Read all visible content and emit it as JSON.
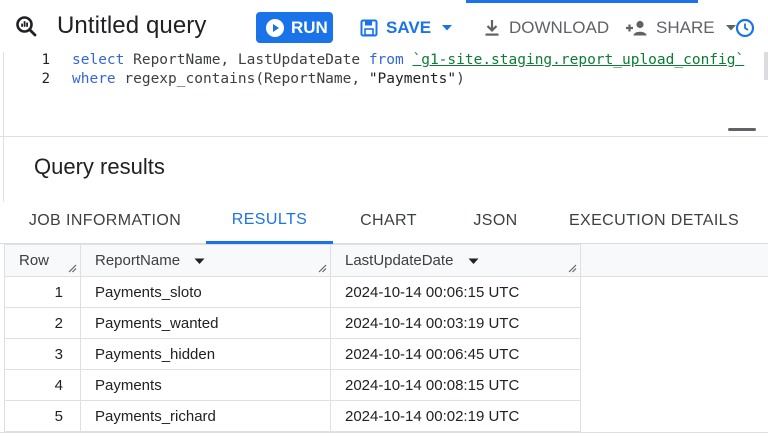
{
  "header": {
    "title": "Untitled query",
    "run_label": "RUN",
    "save_label": "SAVE",
    "download_label": "DOWNLOAD",
    "share_label": "SHARE"
  },
  "editor": {
    "line_numbers": [
      "1",
      "2"
    ],
    "line1": {
      "kw_select": "select",
      "cols": " ReportName, LastUpdateDate ",
      "kw_from": "from",
      "table": "`g1-site.staging.report_upload_config`"
    },
    "line2": {
      "kw_where": "where",
      "func": " regexp_contains(ReportName, ",
      "str": "\"Payments\"",
      "close": ")"
    }
  },
  "results": {
    "title": "Query results",
    "tabs": [
      "JOB INFORMATION",
      "RESULTS",
      "CHART",
      "JSON",
      "EXECUTION DETAILS"
    ],
    "active_tab": "RESULTS",
    "columns": [
      "Row",
      "ReportName",
      "LastUpdateDate"
    ],
    "rows": [
      {
        "row": "1",
        "name": "Payments_sloto",
        "date": "2024-10-14 00:06:15 UTC"
      },
      {
        "row": "2",
        "name": "Payments_wanted",
        "date": "2024-10-14 00:03:19 UTC"
      },
      {
        "row": "3",
        "name": "Payments_hidden",
        "date": "2024-10-14 00:06:45 UTC"
      },
      {
        "row": "4",
        "name": "Payments",
        "date": "2024-10-14 00:08:15 UTC"
      },
      {
        "row": "5",
        "name": "Payments_richard",
        "date": "2024-10-14 00:02:19 UTC"
      }
    ]
  },
  "colors": {
    "accent": "#1a73e8",
    "keyword": "#3367d6",
    "table_ref": "#0d7c34"
  },
  "icons": [
    "query-icon",
    "play-icon",
    "save-icon",
    "download-icon",
    "add-person-icon",
    "clock-icon",
    "chevron-down-icon",
    "sort-caret-icon",
    "resize-grip-icon"
  ]
}
